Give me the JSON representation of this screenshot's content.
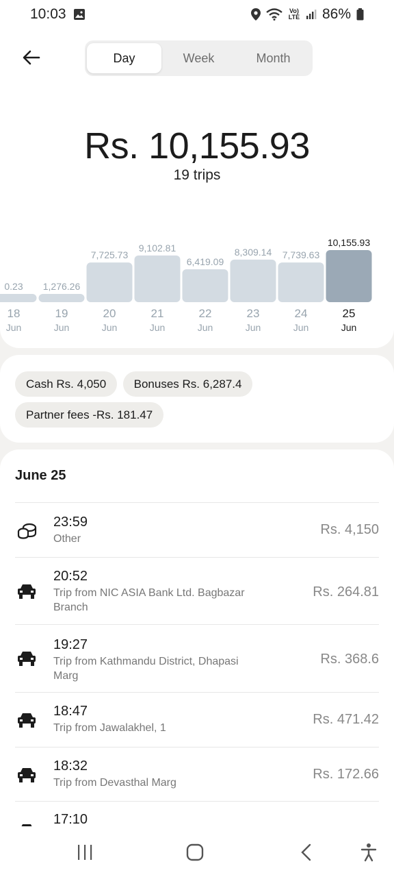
{
  "status": {
    "time": "10:03",
    "battery": "86%",
    "network_label": "Vo) LTE"
  },
  "tabs": [
    {
      "label": "Day",
      "active": true
    },
    {
      "label": "Week",
      "active": false
    },
    {
      "label": "Month",
      "active": false
    }
  ],
  "summary": {
    "total": "Rs. 10,155.93",
    "trips": "19 trips"
  },
  "chart_data": {
    "type": "bar",
    "categories": [
      "18 Jun",
      "19 Jun",
      "20 Jun",
      "21 Jun",
      "22 Jun",
      "23 Jun",
      "24 Jun",
      "25 Jun"
    ],
    "day_labels": [
      "18",
      "19",
      "20",
      "21",
      "22",
      "23",
      "24",
      "25"
    ],
    "month_label": "Jun",
    "value_labels": [
      "0.23",
      "1,276.26",
      "7,725.73",
      "9,102.81",
      "6,419.09",
      "8,309.14",
      "7,739.63",
      "10,155.93"
    ],
    "values": [
      null,
      1276.26,
      7725.73,
      9102.81,
      6419.09,
      8309.14,
      7739.63,
      10155.93
    ],
    "selected_index": 7,
    "colors": {
      "bar": "#d3dbe2",
      "selected": "#9ba9b6",
      "label": "#98a4ae",
      "selected_label": "#1c1c1c"
    }
  },
  "chips": [
    {
      "label": "Cash Rs. 4,050"
    },
    {
      "label": "Bonuses Rs. 6,287.4"
    },
    {
      "label": "Partner fees -Rs. 181.47"
    }
  ],
  "list": {
    "heading": "June 25",
    "items": [
      {
        "icon": "coins-icon",
        "time": "23:59",
        "subtitle": "Other",
        "amount": "Rs. 4,150"
      },
      {
        "icon": "car-icon",
        "time": "20:52",
        "subtitle": "Trip from NIC ASIA Bank Ltd. Bagbazar Branch",
        "amount": "Rs. 264.81"
      },
      {
        "icon": "car-icon",
        "time": "19:27",
        "subtitle": "Trip from Kathmandu District, Dhapasi Marg",
        "amount": "Rs. 368.6"
      },
      {
        "icon": "car-icon",
        "time": "18:47",
        "subtitle": "Trip from Jawalakhel, 1",
        "amount": "Rs. 471.42"
      },
      {
        "icon": "car-icon",
        "time": "18:32",
        "subtitle": "Trip from Devasthal Marg",
        "amount": "Rs. 172.66"
      },
      {
        "icon": "car-icon",
        "time": "17:10",
        "subtitle": "",
        "amount": ""
      }
    ]
  }
}
